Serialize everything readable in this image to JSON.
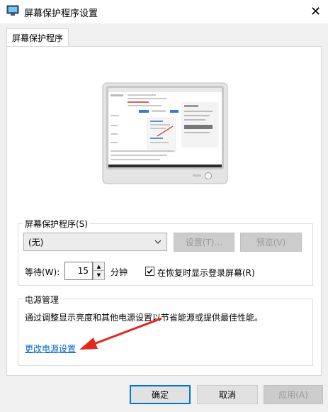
{
  "window": {
    "title": "屏幕保护程序设置",
    "close_glyph": "✕"
  },
  "tab": {
    "label": "屏幕保护程序"
  },
  "screensaver": {
    "group_label": "屏幕保护程序(S)",
    "selected": "(无)",
    "settings_button": "设置(T)...",
    "preview_button": "预览(V)",
    "wait_label": "等待(W):",
    "wait_value": "15",
    "wait_unit": "分钟",
    "resume_checkbox_label": "在恢复时显示登录屏幕(R)",
    "resume_checked": true
  },
  "power": {
    "group_label": "电源管理",
    "description": "通过调整显示亮度和其他电源设置以节省能源或提供最佳性能。",
    "link": "更改电源设置"
  },
  "buttons": {
    "ok": "确定",
    "cancel": "取消",
    "apply": "应用(A)"
  },
  "colors": {
    "link": "#0066cc",
    "annotation_arrow": "#e8241c",
    "focus": "#0078d7"
  }
}
